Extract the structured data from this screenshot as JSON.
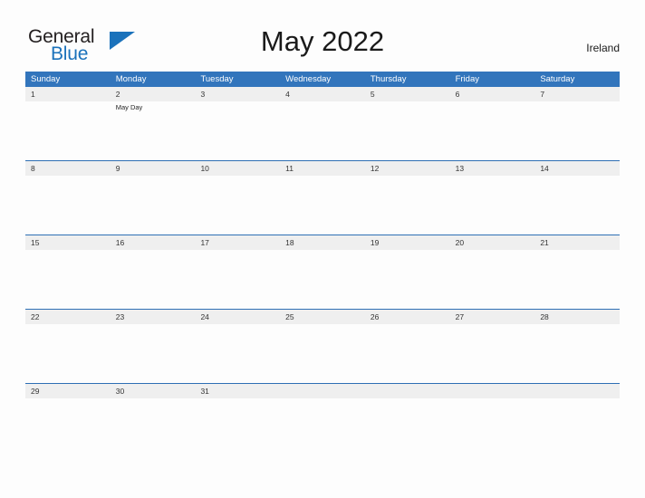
{
  "logo": {
    "line1": "General",
    "line2": "Blue",
    "flag_icon": "triangle-flag-icon",
    "brand_color": "#1b72bb"
  },
  "header": {
    "title": "May 2022",
    "country": "Ireland"
  },
  "colors": {
    "header_blue": "#3275bc",
    "row_separator_blue": "#2e6fb4",
    "date_band_gray": "#efefef",
    "page_background": "#fdfdfd",
    "date_text": "#333333"
  },
  "calendar": {
    "day_headers": [
      "Sunday",
      "Monday",
      "Tuesday",
      "Wednesday",
      "Thursday",
      "Friday",
      "Saturday"
    ],
    "weeks": [
      {
        "dates": [
          "1",
          "2",
          "3",
          "4",
          "5",
          "6",
          "7"
        ],
        "events": [
          "",
          "May Day",
          "",
          "",
          "",
          "",
          ""
        ]
      },
      {
        "dates": [
          "8",
          "9",
          "10",
          "11",
          "12",
          "13",
          "14"
        ],
        "events": [
          "",
          "",
          "",
          "",
          "",
          "",
          ""
        ]
      },
      {
        "dates": [
          "15",
          "16",
          "17",
          "18",
          "19",
          "20",
          "21"
        ],
        "events": [
          "",
          "",
          "",
          "",
          "",
          "",
          ""
        ]
      },
      {
        "dates": [
          "22",
          "23",
          "24",
          "25",
          "26",
          "27",
          "28"
        ],
        "events": [
          "",
          "",
          "",
          "",
          "",
          "",
          ""
        ]
      },
      {
        "dates": [
          "29",
          "30",
          "31",
          "",
          "",
          "",
          ""
        ],
        "events": [
          "",
          "",
          "",
          "",
          "",
          "",
          ""
        ]
      }
    ]
  }
}
